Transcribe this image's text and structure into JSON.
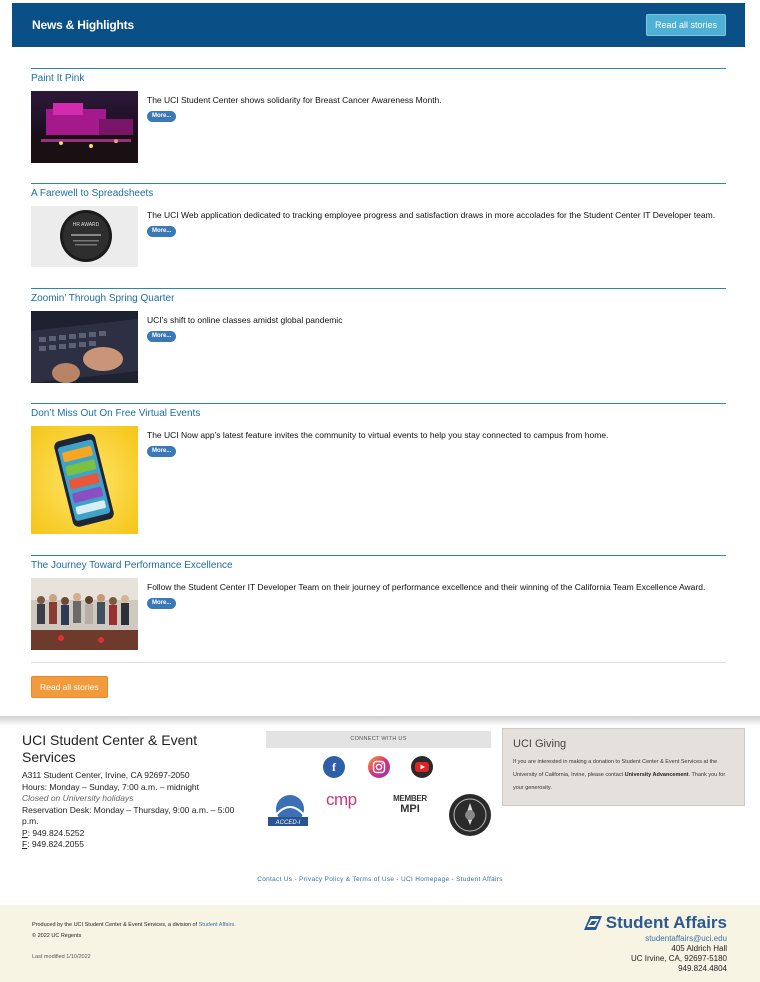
{
  "header": {
    "title": "News & Highlights",
    "read_all": "Read all stories"
  },
  "articles": [
    {
      "title": "Paint It Pink",
      "body": "The UCI Student Center shows solidarity for Breast Cancer Awareness Month.",
      "more": "More..."
    },
    {
      "title": "A Farewell to Spreadsheets",
      "body": "The UCI Web application dedicated to tracking employee progress and satisfaction draws in more accolades for the Student Center IT Developer team.",
      "more": "More...",
      "plaque_text": "HR AWARD"
    },
    {
      "title": "Zoomin’ Through Spring Quarter",
      "body": "UCI’s shift to online classes amidst global pandemic",
      "more": "More..."
    },
    {
      "title": "Don’t Miss Out On Free Virtual Events",
      "body": "The UCI Now app’s latest feature invites the community to virtual events to help you stay connected to campus from home.",
      "more": "More..."
    },
    {
      "title": "The Journey Toward Performance Excellence",
      "body": "Follow the Student Center IT Developer Team on their journey of performance excellence and their winning of the California Team Excellence Award.",
      "more": "More..."
    }
  ],
  "read_all_bottom": "Read all stories",
  "footer": {
    "org_name": "UCI Student Center & Event Services",
    "address": "A311 Student Center, Irvine, CA 92697-2050",
    "hours": "Hours: Monday – Sunday, 7:00 a.m. – midnight",
    "closed": "Closed on University holidays",
    "reservation": "Reservation Desk: Monday – Thursday, 9:00 a.m. – 5:00 p.m.",
    "phone_label": "P",
    "phone": ": 949.824.5252",
    "fax_label": "F",
    "fax": ": 949.824.2055",
    "connect": "CONNECT WITH US",
    "social": [
      "facebook-icon",
      "instagram-icon",
      "youtube-icon"
    ],
    "badges": {
      "cmp": "cmp",
      "mpi_top": "MEMBER",
      "mpi_bottom": "MPI",
      "acced": "ACCED-I"
    },
    "giving_title": "UCI Giving",
    "giving_text": "If you are interested in making a donation to Student Center & Event Services at the University of California, Irvine, please contact",
    "giving_link": "University Advancement",
    "giving_thanks": ". Thank you for your generosity.",
    "links": [
      "Contact Us",
      "Privacy Policy & Terms of Use",
      "UCI Homepage",
      "Student Affairs"
    ],
    "produced_by": "Produced by the UCI Student Center & Event Services, a division of",
    "produced_link": "Student Affairs.",
    "copyright": "© 2022 UC Regents",
    "last_modified": "Last modified 1/10/2022",
    "sa_logo": "Student Affairs",
    "sa_email": "studentaffairs@uci.edu",
    "sa_address1": "405 Aldrich Hall",
    "sa_address2": "UC Irvine, CA, 92697-5180",
    "sa_phone": "949.824.4804"
  },
  "colors": {
    "header": "#0a4f86",
    "accent": "#2a8aa6",
    "orange": "#f29b3c",
    "footer_bar": "#f7f4e4"
  }
}
